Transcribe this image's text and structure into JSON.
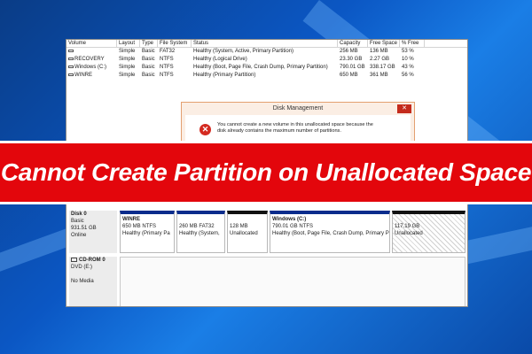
{
  "banner": {
    "title": "Cannot Create Partition on Unallocated Space"
  },
  "volume_table": {
    "columns": [
      "Volume",
      "Layout",
      "Type",
      "File System",
      "Status",
      "Capacity",
      "Free Space",
      "% Free"
    ],
    "rows": [
      {
        "volume": "",
        "layout": "Simple",
        "type": "Basic",
        "fs": "FAT32",
        "status": "Healthy (System, Active, Primary Partition)",
        "capacity": "256 MB",
        "free": "136 MB",
        "pct": "53 %"
      },
      {
        "volume": "RECOVERY",
        "layout": "Simple",
        "type": "Basic",
        "fs": "NTFS",
        "status": "Healthy (Logical Drive)",
        "capacity": "23.30 GB",
        "free": "2.27 GB",
        "pct": "10 %"
      },
      {
        "volume": "Windows (C:)",
        "layout": "Simple",
        "type": "Basic",
        "fs": "NTFS",
        "status": "Healthy (Boot, Page File, Crash Dump, Primary Partition)",
        "capacity": "790.01 GB",
        "free": "338.17 GB",
        "pct": "43 %"
      },
      {
        "volume": "WINRE",
        "layout": "Simple",
        "type": "Basic",
        "fs": "NTFS",
        "status": "Healthy (Primary Partition)",
        "capacity": "650 MB",
        "free": "361 MB",
        "pct": "56 %"
      }
    ]
  },
  "dialog": {
    "title": "Disk Management",
    "close": "✕",
    "icon": "error-icon",
    "line1": "You cannot create a new volume in this unallocated space because the",
    "line2": "disk already contains the maximum number of partitions."
  },
  "disk0": {
    "name": "Disk 0",
    "type": "Basic",
    "size": "931.51 GB",
    "status": "Online",
    "partitions": [
      {
        "name": "WINRE",
        "size": "650 MB NTFS",
        "status": "Healthy (Primary Pa"
      },
      {
        "name": "",
        "size": "260 MB FAT32",
        "status": "Healthy (System,"
      },
      {
        "name": "",
        "size": "128 MB",
        "status": "Unallocated"
      },
      {
        "name": "Windows (C:)",
        "size": "790.01 GB NTFS",
        "status": "Healthy (Boot, Page File, Crash Dump, Primary P"
      },
      {
        "name": "",
        "size": "117.19 GB",
        "status": "Unallocated"
      }
    ]
  },
  "cdrom0": {
    "name": "CD-ROM 0",
    "drive": "DVD (E:)",
    "status": "No Media"
  },
  "colors": {
    "banner_red": "#e3060c",
    "partition_primary": "#0a2c8c",
    "error_red": "#d42a20"
  }
}
